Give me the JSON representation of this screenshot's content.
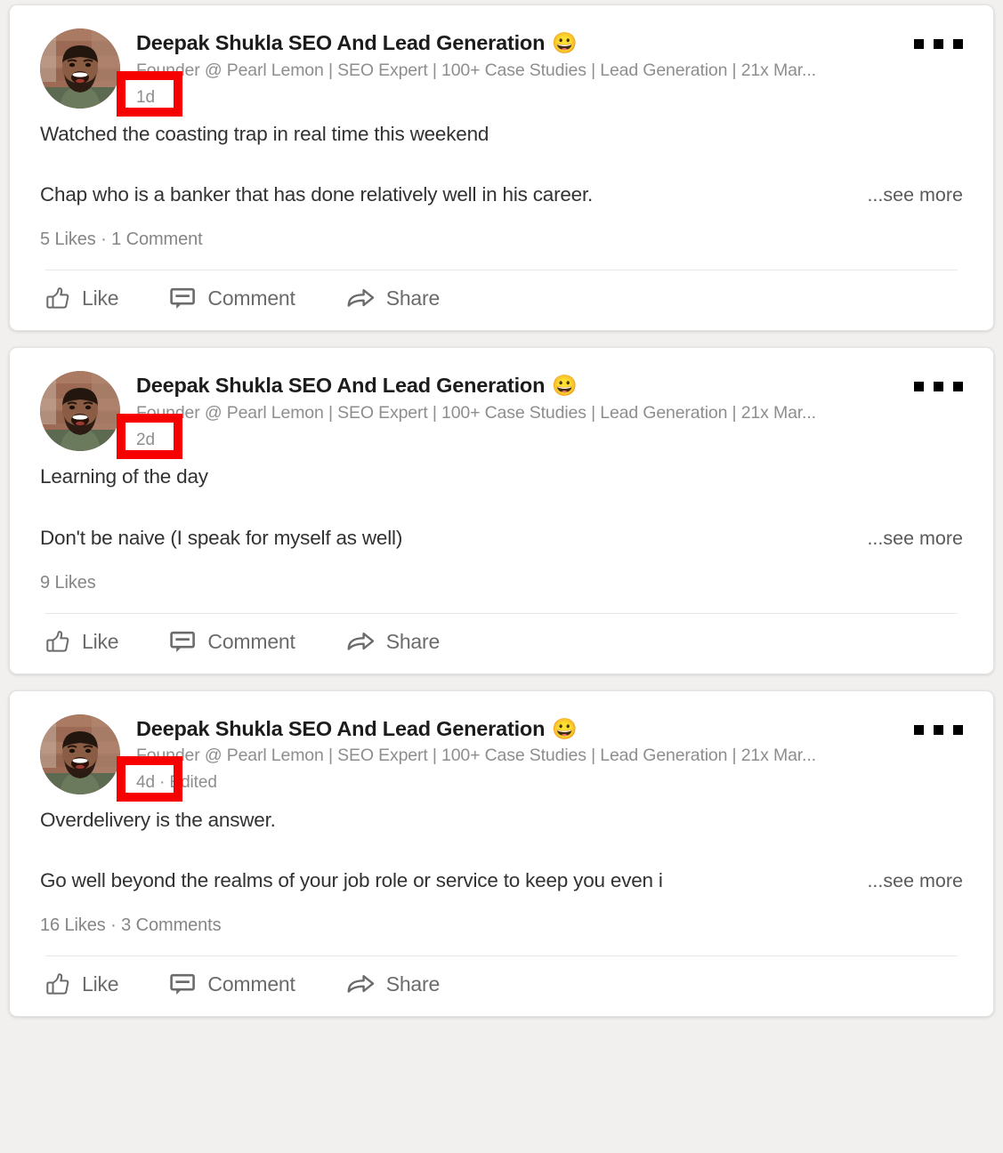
{
  "theme": {
    "page_background": "#f1f0ee",
    "card_background": "#ffffff",
    "highlight_color": "#f60000",
    "name_color": "#1c1c1c",
    "muted_text_color": "#8e8e8e",
    "body_text_color": "#323232"
  },
  "actions": {
    "like_label": "Like",
    "comment_label": "Comment",
    "share_label": "Share",
    "menu_label": "..."
  },
  "see_more_label": "...see more",
  "posts": [
    {
      "author_name": "Deepak Shukla SEO And Lead Generation",
      "author_emoji": "😀",
      "headline": "Founder @ Pearl Lemon | SEO Expert | 100+ Case Studies | Lead Generation | 21x Mar...",
      "timestamp": "1d",
      "body_line_1": "Watched the coasting trap in real time this weekend",
      "body_line_2": "Chap who is a banker that has done relatively well in his career.",
      "engagement": "5 Likes · 1 Comment"
    },
    {
      "author_name": "Deepak Shukla SEO And Lead Generation",
      "author_emoji": "😀",
      "headline": "Founder @ Pearl Lemon | SEO Expert | 100+ Case Studies | Lead Generation | 21x Mar...",
      "timestamp": "2d",
      "body_line_1": "Learning of the day",
      "body_line_2": "Don't be naive (I speak for myself as well)",
      "engagement": "9 Likes"
    },
    {
      "author_name": "Deepak Shukla SEO And Lead Generation",
      "author_emoji": "😀",
      "headline": "Founder @ Pearl Lemon | SEO Expert | 100+ Case Studies | Lead Generation | 21x Mar...",
      "timestamp": "4d · Edited",
      "body_line_1": "Overdelivery is the answer.",
      "body_line_2": "Go well beyond the realms of your job role or service to keep you even i",
      "engagement": "16 Likes · 3 Comments"
    }
  ]
}
